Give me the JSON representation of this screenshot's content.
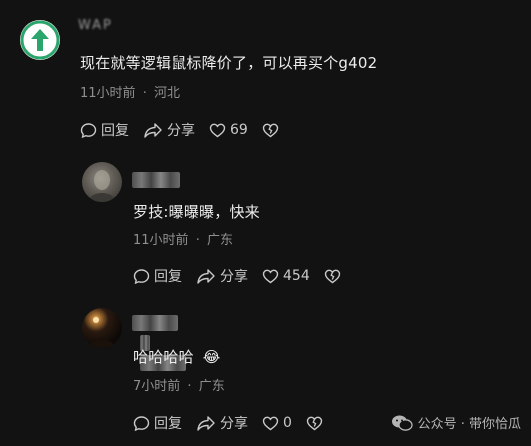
{
  "comments": [
    {
      "username": "WAP",
      "text": "现在就等逻辑鼠标降价了，可以再买个g402",
      "time": "11小时前",
      "location": "河北",
      "reply_label": "回复",
      "share_label": "分享",
      "likes": "69"
    },
    {
      "text": "罗技:曝曝曝，快来",
      "time": "11小时前",
      "location": "广东",
      "reply_label": "回复",
      "share_label": "分享",
      "likes": "454"
    },
    {
      "text": "哈哈哈哈",
      "emoji": "😂",
      "time": "7小时前",
      "location": "广东",
      "reply_label": "回复",
      "share_label": "分享",
      "likes": "0"
    }
  ],
  "meta_separator": "·",
  "watermark": {
    "text": "公众号 · 带你恰瓜"
  },
  "colors": {
    "background": "#121212",
    "accent_green": "#2aa56b"
  }
}
